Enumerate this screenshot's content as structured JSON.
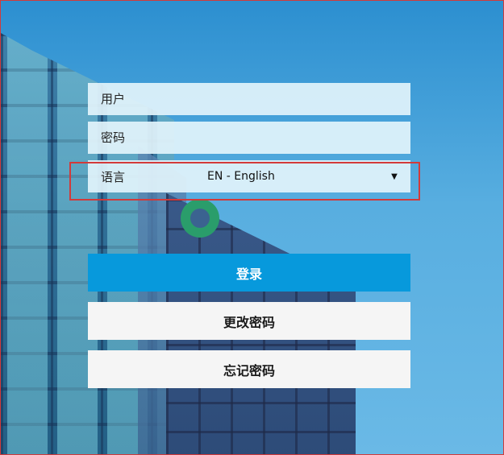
{
  "login_form": {
    "user_placeholder": "用户",
    "user_value": "",
    "password_placeholder": "密码",
    "password_value": "",
    "language_label": "语言",
    "language_selected": "EN - English",
    "language_caret": "▼"
  },
  "buttons": {
    "login": "登录",
    "change_password": "更改密码",
    "forgot_password": "忘记密码"
  },
  "colors": {
    "primary": "#0799dc",
    "secondary_button": "#f5f5f5",
    "highlight": "#d23a3a"
  }
}
